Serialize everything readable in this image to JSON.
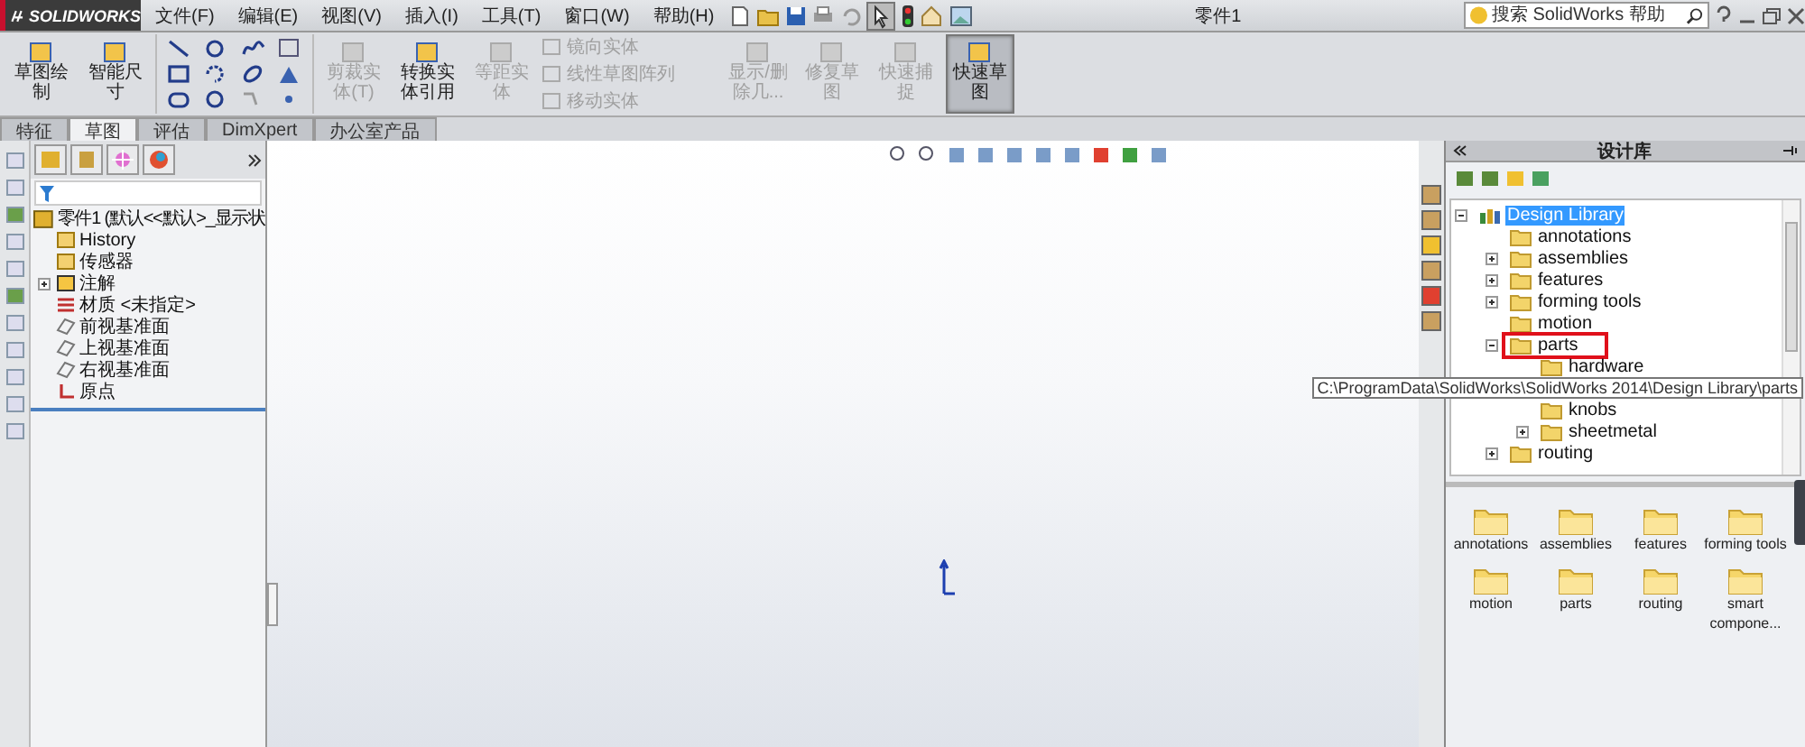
{
  "app": {
    "logo": "SOLIDWORKS",
    "title": "零件1"
  },
  "menus": [
    "文件(F)",
    "编辑(E)",
    "视图(V)",
    "插入(I)",
    "工具(T)",
    "窗口(W)",
    "帮助(H)"
  ],
  "search": {
    "placeholder": "搜索 SolidWorks 帮助"
  },
  "toolbar": [
    {
      "kind": "big",
      "label": "草图绘制",
      "disabled": false,
      "selected": false
    },
    {
      "kind": "big",
      "label": "智能尺寸",
      "disabled": false,
      "selected": false
    },
    {
      "kind": "tools"
    },
    {
      "kind": "big",
      "label": "剪裁实体(T)",
      "disabled": true,
      "selected": false
    },
    {
      "kind": "big",
      "label": "转换实体引用",
      "disabled": false,
      "selected": false
    },
    {
      "kind": "big",
      "label": "等距实体",
      "disabled": true,
      "selected": false
    },
    {
      "kind": "stack",
      "items": [
        {
          "label": "镜向实体",
          "disabled": true
        },
        {
          "label": "线性草图阵列",
          "disabled": true
        },
        {
          "label": "移动实体",
          "disabled": true
        }
      ]
    },
    {
      "kind": "big",
      "label": "显示/删除几...",
      "disabled": true,
      "selected": false
    },
    {
      "kind": "big",
      "label": "修复草图",
      "disabled": true,
      "selected": false
    },
    {
      "kind": "big",
      "label": "快速捕捉",
      "disabled": true,
      "selected": false
    },
    {
      "kind": "big",
      "label": "快速草图",
      "disabled": false,
      "selected": true
    }
  ],
  "tabs": [
    {
      "label": "特征",
      "selected": false
    },
    {
      "label": "草图",
      "selected": true
    },
    {
      "label": "评估",
      "selected": false
    },
    {
      "label": "DimXpert",
      "selected": false
    },
    {
      "label": "办公室产品",
      "selected": false
    }
  ],
  "feature_tree": {
    "root": "零件1 (默认<<默认>_显示状",
    "children": [
      {
        "kind": "history",
        "label": "History"
      },
      {
        "kind": "sensor",
        "label": "传感器"
      },
      {
        "kind": "annotation",
        "label": "注解",
        "expanded": false
      },
      {
        "kind": "material",
        "label": "材质 <未指定>"
      },
      {
        "kind": "plane",
        "label": "前视基准面"
      },
      {
        "kind": "plane",
        "label": "上视基准面"
      },
      {
        "kind": "plane",
        "label": "右视基准面"
      },
      {
        "kind": "origin",
        "label": "原点"
      }
    ]
  },
  "library": {
    "title": "设计库",
    "tree": [
      {
        "label": "Design Library",
        "kind": "library",
        "selected": true,
        "expanded": true,
        "children": [
          {
            "label": "annotations",
            "kind": "folder",
            "selected": false
          },
          {
            "label": "assemblies",
            "kind": "folder",
            "selected": false,
            "expanded": false
          },
          {
            "label": "features",
            "kind": "folder",
            "selected": false,
            "expanded": false
          },
          {
            "label": "forming tools",
            "kind": "folder",
            "selected": false,
            "expanded": false
          },
          {
            "label": "motion",
            "kind": "folder",
            "selected": false
          },
          {
            "label": "parts",
            "kind": "folder",
            "selected": false,
            "highlighted": true,
            "expanded": true,
            "children": [
              {
                "label": "hardware",
                "kind": "folder",
                "selected": false,
                "tooltip": "C:\\ProgramData\\SolidWorks\\SolidWorks 2014\\Design Library\\parts"
              },
              {
                "label": "knobs",
                "kind": "folder",
                "selected": false
              },
              {
                "label": "sheetmetal",
                "kind": "folder",
                "selected": false,
                "expanded": false
              }
            ]
          },
          {
            "label": "routing",
            "kind": "folder",
            "selected": false,
            "expanded": false
          }
        ]
      }
    ],
    "folders": [
      "annotations",
      "assemblies",
      "features",
      "forming tools",
      "motion",
      "parts",
      "routing",
      "smart compone..."
    ]
  }
}
